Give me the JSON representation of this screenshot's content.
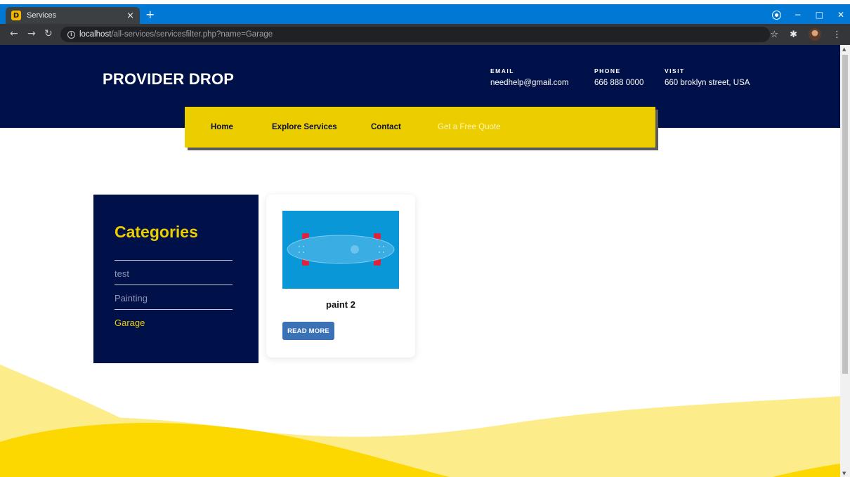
{
  "browser": {
    "tab_title": "Services",
    "tab_favicon_letter": "D",
    "tab_close": "×",
    "new_tab": "+",
    "url_host": "localhost",
    "url_path": "/all-services/servicesfilter.php?name=Garage",
    "icons": [
      "back-icon",
      "forward-icon",
      "reload-icon",
      "info-icon",
      "star-icon",
      "extensions-icon",
      "profile-avatar",
      "menu-icon",
      "minimize-icon",
      "restore-icon",
      "close-icon"
    ],
    "accent": "#0078d4"
  },
  "header": {
    "brand": "PROVIDER DROP",
    "email_label": "EMAIL",
    "email_value": "needhelp@gmail.com",
    "phone_label": "PHONE",
    "phone_value": "666 888 0000",
    "visit_label": "VISIT",
    "visit_value": "660 broklyn street, USA",
    "background": "#001048"
  },
  "nav": {
    "items": [
      {
        "label": "Home"
      },
      {
        "label": "Explore Services"
      },
      {
        "label": "Contact"
      },
      {
        "label": "Get a Free Quote"
      }
    ],
    "background": "#ebcd00"
  },
  "sidebar": {
    "title": "Categories",
    "categories": [
      {
        "label": "test",
        "active": false
      },
      {
        "label": "Painting",
        "active": false
      },
      {
        "label": "Garage",
        "active": true
      }
    ]
  },
  "services": [
    {
      "title": "paint 2",
      "button_label": "READ MORE",
      "image": "skateboard-image"
    }
  ],
  "colors": {
    "accent_yellow": "#ebcd00",
    "navy": "#001048",
    "button_blue": "#3a72b5",
    "wave_light": "#fdec8a",
    "wave_dark": "#fdd800"
  }
}
